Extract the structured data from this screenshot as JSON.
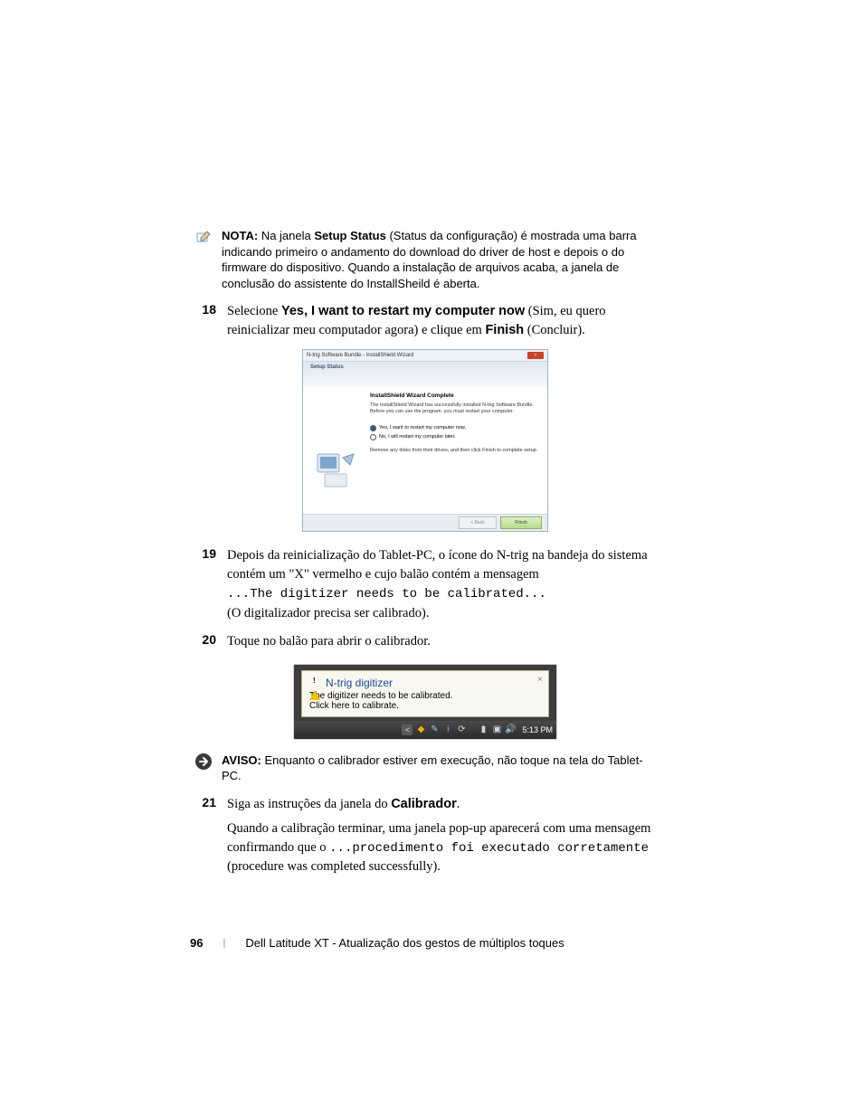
{
  "callouts": {
    "nota_label": "NOTA:",
    "nota_text": "Na janela Setup Status (Status da configuração) é mostrada uma barra indicando primeiro o andamento do download do driver de host e depois o do firmware do dispositivo. Quando a instalação de arquivos acaba, a janela de conclusão do assistente do InstallSheild é aberta.",
    "nota_bold": "Setup Status",
    "aviso_label": "AVISO:",
    "aviso_text": "Enquanto o calibrador estiver em execução, não toque na tela do Tablet-PC."
  },
  "steps": {
    "s18": {
      "num": "18",
      "pre": "Selecione ",
      "bold1": "Yes, I want to restart my computer now",
      "mid": " (Sim, eu quero reinicializar meu computador agora) e clique em ",
      "bold2": "Finish",
      "post": " (Concluir)."
    },
    "s19": {
      "num": "19",
      "line1": "Depois da reinicialização do Tablet-PC, o ícone do N-trig na bandeja do sistema contém um \"X\" vermelho e cujo balão contém a mensagem",
      "code": "...The digitizer needs to be calibrated...",
      "line2": "(O digitalizador precisa ser calibrado)."
    },
    "s20": {
      "num": "20",
      "text": "Toque no balão para abrir o calibrador."
    },
    "s21": {
      "num": "21",
      "pre": "Siga as instruções da janela do ",
      "bold1": "Calibrador",
      "post": ".",
      "line2a": "Quando a calibração terminar, uma janela pop-up aparecerá com uma mensagem confirmando que o ",
      "code": "...procedimento foi executado corretamente",
      "line2b": " (procedure was completed successfully)."
    }
  },
  "installer": {
    "titlebar": "N-trig Software Bundle - InstallShield Wizard",
    "banner": "Setup Status",
    "heading": "InstallShield Wizard Complete",
    "para": "The InstallShield Wizard has successfully installed N-trig Software Bundle. Before you can use the program, you must restart your computer.",
    "opt_yes": "Yes, I want to restart my computer now.",
    "opt_no": "No, I will restart my computer later.",
    "para2": "Remove any disks from their drives, and then click Finish to complete setup.",
    "btn_finish": "Finish",
    "btn_back": "< Back"
  },
  "balloon": {
    "title": "N-trig digitizer",
    "line1": "The digitizer needs to be calibrated.",
    "line2": "Click here to calibrate.",
    "close": "×"
  },
  "taskbar": {
    "time": "5:13 PM"
  },
  "footer": {
    "page": "96",
    "sep": "|",
    "title": "Dell Latitude XT - Atualização dos gestos de múltiplos toques"
  }
}
